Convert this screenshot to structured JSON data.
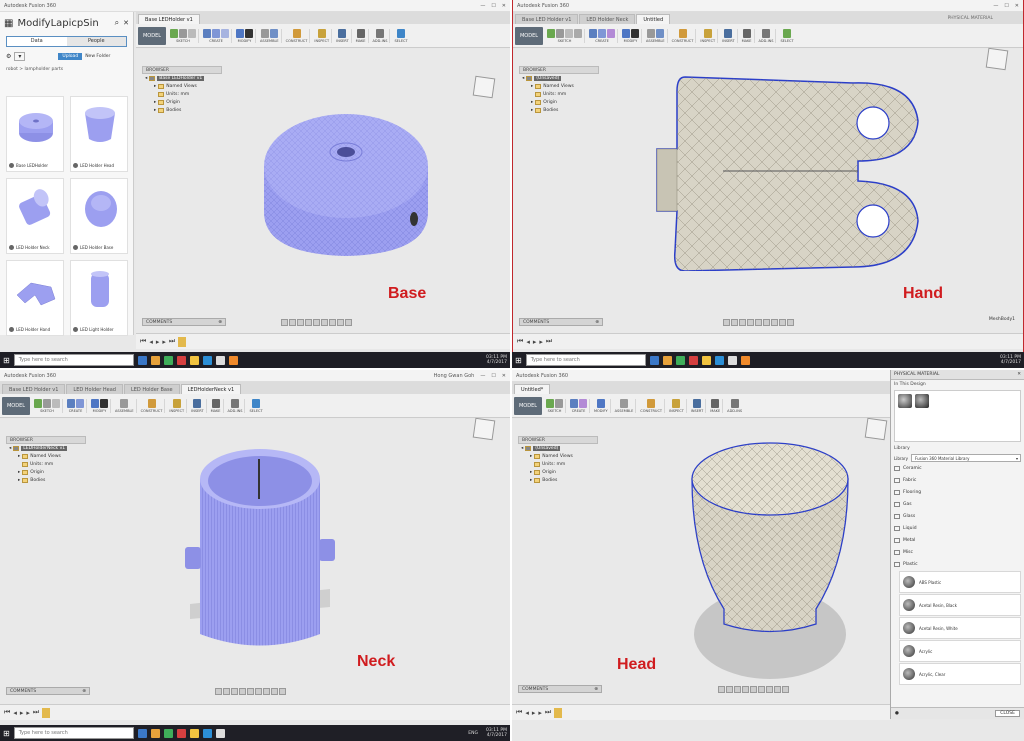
{
  "colors": {
    "label_red": "#d01c1f",
    "part_blue": "#9c9ff0",
    "mesh_grey": "#d8d4c6",
    "taskbar": "#1f1f26",
    "mode_button": "#5e6b78"
  },
  "labels": {
    "base": "Base",
    "hand": "Hand",
    "neck": "Neck",
    "head": "Head"
  },
  "app": {
    "title": "Autodesk Fusion 360",
    "user": "Hong Gwan Goh",
    "mode": "MODEL",
    "browser_header": "BROWSER",
    "comments": "COMMENTS",
    "toolbar_groups": [
      "SKETCH",
      "CREATE",
      "MODIFY",
      "ASSEMBLE",
      "CONSTRUCT",
      "INSPECT",
      "INSERT",
      "MAKE",
      "ADD-INS",
      "SELECT"
    ],
    "tree": [
      "Named Views",
      "Units: mm",
      "Origin",
      "Bodies"
    ]
  },
  "q1": {
    "tab": "Base LEDHolder v1",
    "root": "Base LEDHolder v1",
    "panel_title": "ModifyLapicpSin",
    "tab_data": "Data",
    "tab_people": "People",
    "upload": "Upload",
    "new_folder": "New Folder",
    "crumb": "robot  >  lampholder parts",
    "items": [
      "Base LEDHolder",
      "LED Holder Head",
      "LED Holder Neck",
      "LED Holder Base",
      "LED Holder Hand",
      "LED Light Holder"
    ]
  },
  "q2": {
    "tab1": "Base LED Holder v1",
    "tab2": "LED Holder Neck",
    "tab3": "Untitled",
    "root": "(Unsaved)",
    "right_panel": "PHYSICAL MATERIAL",
    "corner_note": "MeshBody1"
  },
  "q3": {
    "tab1": "Base LED Holder v1",
    "tab2": "LED Holder Head",
    "tab3": "LED Holder Base",
    "tab4": "LEDHolderNeck v1",
    "root": "LEDHolderNeck v1",
    "clock_time": "03:11 PM",
    "clock_date": "4/7/2017",
    "lang": "ENG"
  },
  "q4": {
    "tab": "Untitled*",
    "root": "(Unsaved)",
    "panel_title": "PHYSICAL MATERIAL",
    "in_design": "In This Design",
    "library": "Library",
    "library_label": "Library",
    "library_select": "Fusion 360 Material Library",
    "categories": [
      "Ceramic",
      "Fabric",
      "Flooring",
      "Gas",
      "Glass",
      "Liquid",
      "Metal",
      "Misc",
      "Plastic"
    ],
    "materials": [
      "ABS Plastic",
      "Acetal Resin, Black",
      "Acetal Resin, White",
      "Acrylic",
      "Acrylic, Clear"
    ],
    "close": "CLOSE"
  },
  "taskbar": {
    "search_placeholder": "Type here to search",
    "time": "03:11 PM",
    "date": "4/7/2017"
  }
}
